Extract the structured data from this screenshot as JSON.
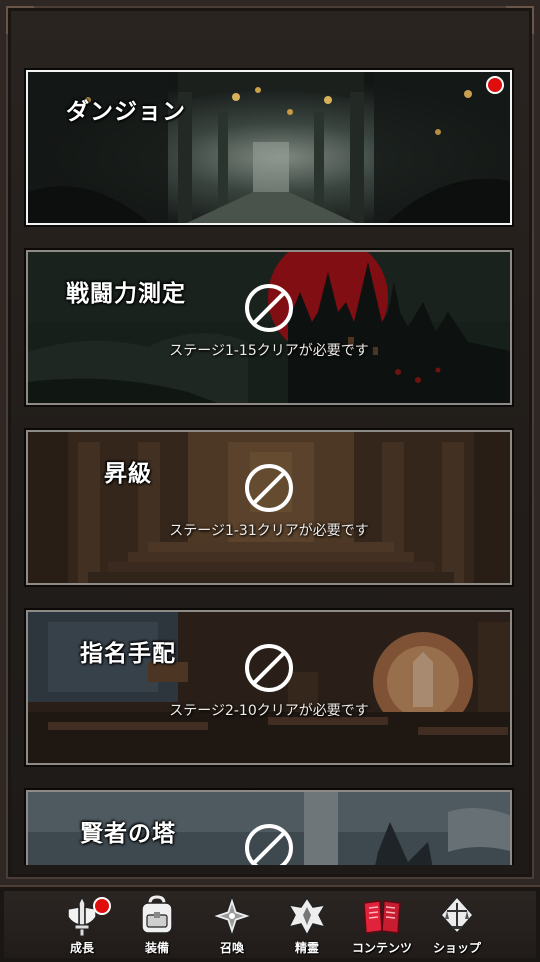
{
  "cards": [
    {
      "title": "ダンジョン",
      "locked": false,
      "badge": true
    },
    {
      "title": "戦闘力測定",
      "locked": true,
      "requirement": "ステージ1-15クリアが必要です"
    },
    {
      "title": "昇級",
      "locked": true,
      "requirement": "ステージ1-31クリアが必要です"
    },
    {
      "title": "指名手配",
      "locked": true,
      "requirement": "ステージ2-10クリアが必要です"
    },
    {
      "title": "賢者の塔",
      "locked": true
    }
  ],
  "nav": {
    "items": [
      {
        "label": "成長",
        "icon": "sword-shield-icon",
        "badge": true
      },
      {
        "label": "装備",
        "icon": "backpack-icon"
      },
      {
        "label": "召喚",
        "icon": "star-compass-icon"
      },
      {
        "label": "精霊",
        "icon": "spirit-emblem-icon"
      },
      {
        "label": "コンテンツ",
        "icon": "book-icon",
        "active": true
      },
      {
        "label": "ショップ",
        "icon": "scales-icon"
      }
    ],
    "active_color": "#e0233a"
  },
  "colors": {
    "badge": "#e00d0d",
    "moon": "#b3141a"
  }
}
